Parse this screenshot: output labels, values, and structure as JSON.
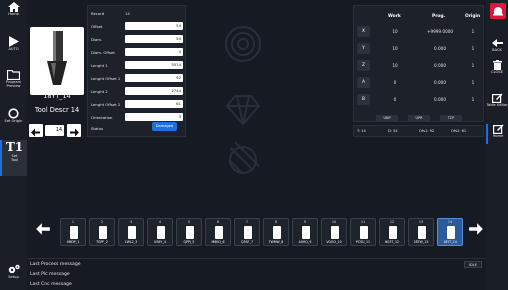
{
  "left_sidebar": {
    "items": [
      {
        "label": "Home"
      },
      {
        "label": "AUTO"
      },
      {
        "label": "Program Preview"
      },
      {
        "label": "Set Origin"
      },
      {
        "label": "Set Tool",
        "glyph": "T1"
      },
      {
        "label": "Setup"
      }
    ]
  },
  "right_sidebar": {
    "items": [
      {
        "label": "BACK"
      },
      {
        "label": "CLOSE"
      },
      {
        "label": "Table Editor"
      },
      {
        "label": "Home"
      }
    ],
    "alarm_color": "#e1143c"
  },
  "tool_preview": {
    "tool_id": "18YT_14",
    "description": "Tool Descr 14",
    "current_number": "14"
  },
  "params": {
    "record_label": "Record",
    "record_value": "14",
    "fields": [
      {
        "label": "Offset",
        "value": "54"
      },
      {
        "label": "Diam.",
        "value": "54"
      },
      {
        "label": "Diam. Offset",
        "value": "0"
      },
      {
        "label": "Lenght 1",
        "value": "5514"
      },
      {
        "label": "Lenght Offset 1",
        "value": "92"
      },
      {
        "label": "Lenght 2",
        "value": "2744"
      },
      {
        "label": "Lenght Offset 2",
        "value": "61"
      },
      {
        "label": "Orientation",
        "value": "3"
      }
    ],
    "status_label": "Status",
    "status_value": "Damaged",
    "status_color": "#1f6fe0"
  },
  "coords": {
    "headers": {
      "work": "Work",
      "prog": "Prog.",
      "origin": "Origin"
    },
    "rows": [
      {
        "axis": "X",
        "work": "10",
        "prog": "+9999.0000",
        "origin": "1"
      },
      {
        "axis": "Y",
        "work": "10",
        "prog": "0.000",
        "origin": "1"
      },
      {
        "axis": "Z",
        "work": "10",
        "prog": "0.000",
        "origin": "1"
      },
      {
        "axis": "A",
        "work": "0",
        "prog": "0.000",
        "origin": "1"
      },
      {
        "axis": "B",
        "work": "0",
        "prog": "0.000",
        "origin": "1"
      }
    ],
    "modes": [
      "UNP",
      "UPR",
      "TCP"
    ]
  },
  "status_strip": {
    "tool": "T: 14",
    "d": "D: 54",
    "ofs1": "Ofs1: 92",
    "ofs2": "Ofs2: 61"
  },
  "tools": [
    {
      "num": "1",
      "label": "4MDP_1"
    },
    {
      "num": "2",
      "label": "TGPF_2"
    },
    {
      "num": "3",
      "label": "1WL2_3"
    },
    {
      "num": "4",
      "label": "US6Y_4"
    },
    {
      "num": "5",
      "label": "QPPJ_5"
    },
    {
      "num": "6",
      "label": "M8KQ_6"
    },
    {
      "num": "7",
      "label": "Q3SF_7"
    },
    {
      "num": "8",
      "label": "TWMW_8"
    },
    {
      "num": "9",
      "label": "A0HQ_9"
    },
    {
      "num": "10",
      "label": "VGGO_10"
    },
    {
      "num": "11",
      "label": "PCSU_11"
    },
    {
      "num": "12",
      "label": "N03T_12"
    },
    {
      "num": "13",
      "label": "28TW_13"
    },
    {
      "num": "14",
      "label": "18YT_14"
    }
  ],
  "selected_tool_index": 13,
  "messages": {
    "process": "Last Process message",
    "plc": "Last Plc message",
    "cnc": "Last Cnc message",
    "state": "IDLE"
  }
}
